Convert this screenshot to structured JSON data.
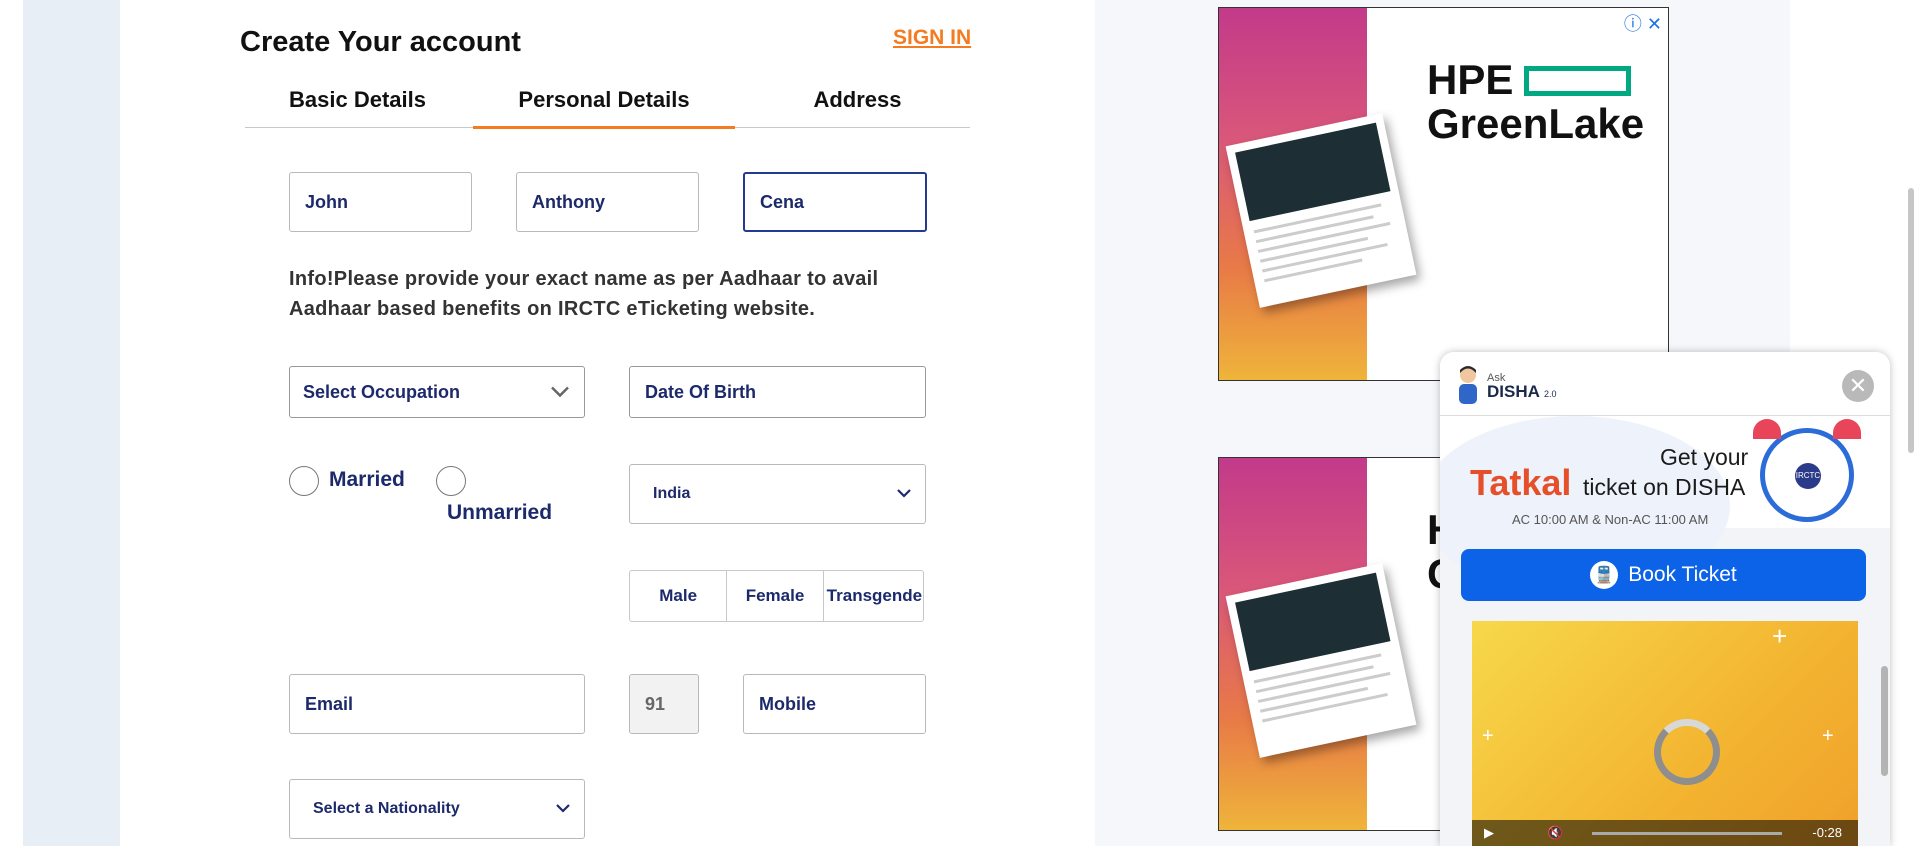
{
  "form": {
    "title": "Create Your account",
    "sign_in": "SIGN IN",
    "tabs": [
      {
        "label": "Basic Details"
      },
      {
        "label": "Personal Details",
        "active": true
      },
      {
        "label": "Address"
      }
    ],
    "first_name": "John",
    "middle_name": "Anthony",
    "last_name": "Cena",
    "info": "Info!Please provide your exact name as per Aadhaar to avail Aadhaar based benefits on IRCTC eTicketing website.",
    "occupation": "Select Occupation",
    "dob": "Date Of Birth",
    "married_label": "Married",
    "unmarried_label": "Unmarried",
    "country": "India",
    "gender": [
      "Male",
      "Female",
      "Transgender"
    ],
    "email": "Email",
    "country_code": "91",
    "mobile": "Mobile",
    "nationality": "Select a Nationality"
  },
  "ads": {
    "brand_line1": "HPE",
    "brand_line2": "GreenLake",
    "brand_color": "#01a982"
  },
  "disha": {
    "ask": "Ask",
    "name": "DISHA",
    "version": "2.0",
    "get_your": "Get your",
    "tatkal": "Tatkal",
    "ticket_on": "ticket on DISHA",
    "times": "AC 10:00 AM & Non-AC 11:00 AM",
    "book_ticket": "Book Ticket",
    "video_time": "-0:28",
    "accent": "#0d63e8"
  },
  "colors": {
    "accent": "#f47b20",
    "text_blue": "#1c2a6b"
  }
}
